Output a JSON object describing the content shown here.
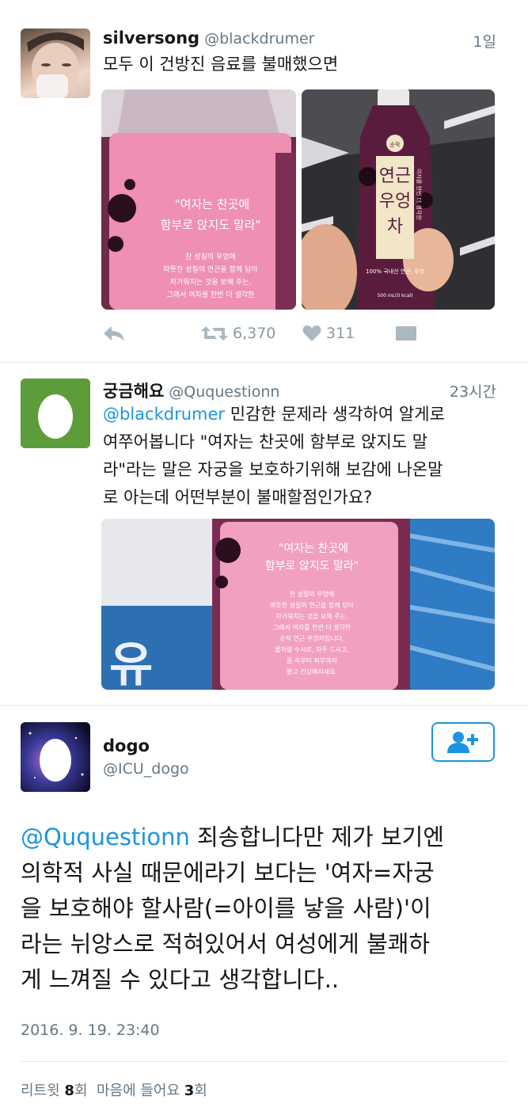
{
  "tweet1": {
    "name": "silversong",
    "handle": "@blackdrumer",
    "time": "1일",
    "text": "모두 이 건방진 음료를 불매했으면",
    "retweets": "6,370",
    "likes": "311",
    "image1": {
      "quote_line1": "\"여자는 찬곳에",
      "quote_line2": "함부로 앉지도 말라\"",
      "body_line1": "찬 성질의 우엉에",
      "body_line2": "따뜻한 성질의 연근을 함께 담아",
      "body_line3": "차가워지는 것을 보해 주는,",
      "body_line4": "그래서 여자를 한번 더 생각한"
    },
    "image2": {
      "brand": "순작",
      "product_line1": "연근",
      "product_line2": "우엉",
      "product_line3": "차",
      "side_text": "여자를 한번 더 생각한",
      "sub": "100% 국내산 연근, 우엉",
      "volume": "500 mL(0 kcal)"
    }
  },
  "tweet2": {
    "name": "궁금해요",
    "handle": "@Ququestionn",
    "time": "23시간",
    "mention": "@blackdrumer",
    "text_line1": " 민감한 문제라 생각하여 알게로",
    "text_line2": "여쭈어봅니다 \"여자는 찬곳에 함부로 앉지도 말",
    "text_line3": "라\"라는 말은 자궁을 보호하기위해 보감에 나온말",
    "text_line4": "로 아는데 어떤부분이 불매할점인가요?",
    "image": {
      "quote_line1": "\"여자는 찬곳에",
      "quote_line2": "함부로 앉지도 말라\"",
      "body_line1": "찬 성질의 우엉에",
      "body_line2": "따뜻한 성질의 연근을 함께 담아",
      "body_line3": "차가워지는 것을 보해 주는,",
      "body_line4": "그래서 여자를 한번 더 생각한",
      "body_line5": "순작 연근 우엉차입니다.",
      "body_line6": "물처럼 수시로, 자주 드시고,",
      "body_line7": "몸 속부터 피부까지",
      "body_line8": "맑고 건강해지세요."
    }
  },
  "tweet3": {
    "name": "dogo",
    "handle": "@ICU_dogo",
    "mention": "@Ququestionn",
    "line1": " 죄송합니다만 제가 보기엔",
    "line2": "의학적 사실 때문에라기 보다는 '여자=자궁",
    "line3": "을 보호해야 할사람(=아이를 낳을 사람)'이",
    "line4": "라는 뉘앙스로 적혀있어서 여성에게 불쾌하",
    "line5": "게 느껴질 수 있다고 생각합니다..",
    "date": "2016. 9. 19. 23:40",
    "retweet_label": "리트윗 ",
    "retweet_count": "8",
    "retweet_unit": "회",
    "like_label": "  마음에 들어요 ",
    "like_count": "3",
    "like_unit": "회"
  },
  "colors": {
    "accent": "#1b95e0",
    "text": "#14171a",
    "muted": "#657786",
    "divider": "#e1e8ed"
  }
}
